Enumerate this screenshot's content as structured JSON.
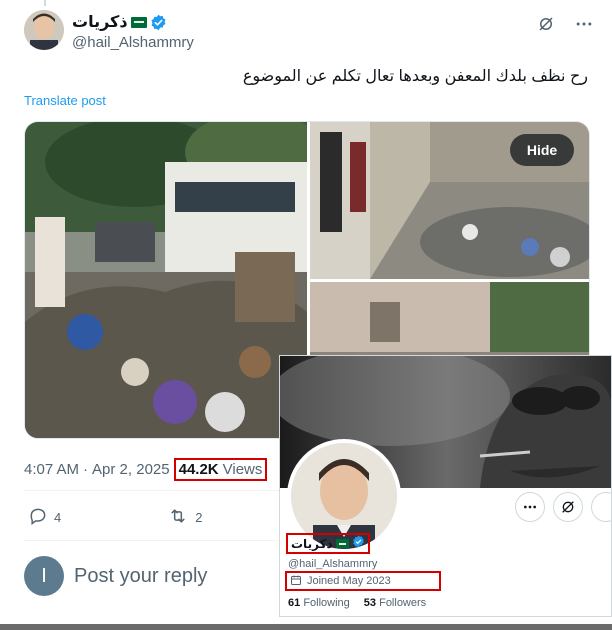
{
  "post": {
    "author": {
      "display_name": "ذكريات",
      "handle": "@hail_Alshammry",
      "verified": true,
      "flag": "saudi-flag"
    },
    "text": "رح نظف بلدك المعفن وبعدها تعال تكلم عن الموضوع",
    "translate_label": "Translate post",
    "media": {
      "hide_label": "Hide",
      "photos": [
        "street-garbage-photo",
        "alley-garbage-photo",
        "building-garbage-photo"
      ]
    },
    "time": "4:07 AM",
    "separator": "·",
    "date": "Apr 2, 2025",
    "views_count": "44.2K",
    "views_label": "Views",
    "actions": {
      "replies": "4",
      "reposts": "2"
    },
    "reply_avatar_letter": "I",
    "reply_placeholder": "Post your reply"
  },
  "profile_card": {
    "display_name": "ذكريات",
    "handle": "@hail_Alshammry",
    "joined": "Joined May 2023",
    "following_count": "61",
    "following_label": "Following",
    "followers_count": "53",
    "followers_label": "Followers"
  },
  "colors": {
    "accent": "#1d9bf0",
    "highlight_box": "#d40000",
    "muted_text": "#536471"
  }
}
